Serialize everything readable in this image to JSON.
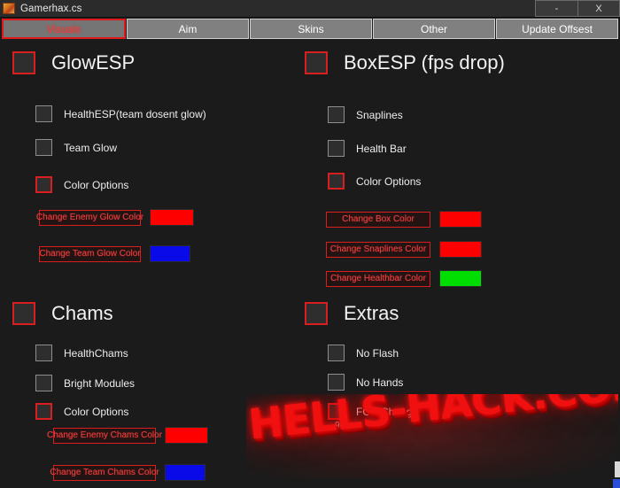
{
  "window": {
    "title": "Gamerhax.cs",
    "icon": "app-icon",
    "minimize_label": "-",
    "close_label": "X"
  },
  "tabs": [
    {
      "label": "Visuals",
      "active": true
    },
    {
      "label": "Aim",
      "active": false
    },
    {
      "label": "Skins",
      "active": false
    },
    {
      "label": "Other",
      "active": false
    },
    {
      "label": "Update Offsest",
      "active": false
    }
  ],
  "sections": {
    "glowesp": {
      "title": "GlowESP",
      "enabled": false,
      "options": [
        {
          "label": "HealthESP(team dosent glow)",
          "checked": false,
          "accent": "gray"
        },
        {
          "label": "Team Glow",
          "checked": false,
          "accent": "gray"
        },
        {
          "label": "Color Options",
          "checked": false,
          "accent": "red"
        }
      ],
      "color_buttons": [
        {
          "label": "Change Enemy Glow Color",
          "color": "#ff0000"
        },
        {
          "label": "Change Team Glow Color",
          "color": "#0a0ae8"
        }
      ]
    },
    "boxesp": {
      "title": "BoxESP (fps drop)",
      "enabled": false,
      "options": [
        {
          "label": "Snaplines",
          "checked": false,
          "accent": "gray"
        },
        {
          "label": "Health Bar",
          "checked": false,
          "accent": "gray"
        },
        {
          "label": "Color Options",
          "checked": false,
          "accent": "red"
        }
      ],
      "color_buttons": [
        {
          "label": "Change Box Color",
          "color": "#ff0000"
        },
        {
          "label": "Change Snaplines Color",
          "color": "#ff0000"
        },
        {
          "label": "Change Healthbar Color",
          "color": "#00dd00"
        }
      ]
    },
    "chams": {
      "title": "Chams",
      "enabled": false,
      "options": [
        {
          "label": "HealthChams",
          "checked": false,
          "accent": "gray"
        },
        {
          "label": "Bright Modules",
          "checked": false,
          "accent": "gray"
        },
        {
          "label": "Color Options",
          "checked": false,
          "accent": "red"
        }
      ],
      "color_buttons": [
        {
          "label": "Change Enemy Chams Color",
          "color": "#ff0000"
        },
        {
          "label": "Change Team Chams Color",
          "color": "#0a0ae8"
        }
      ]
    },
    "extras": {
      "title": "Extras",
      "enabled": false,
      "options": [
        {
          "label": "No Flash",
          "checked": false,
          "accent": "gray"
        },
        {
          "label": "No Hands",
          "checked": false,
          "accent": "gray"
        },
        {
          "label": "FOV Changer",
          "checked": false,
          "accent": "red"
        }
      ],
      "fov_value": "90"
    }
  },
  "watermark": {
    "text": "HELLS-HACK.COM",
    "color": "#f01010"
  },
  "colors": {
    "accent_red": "#d81f1f",
    "window_bg": "#1b1b1b",
    "titlebar_bg": "#2b2b2b",
    "tab_bg": "#808080"
  }
}
